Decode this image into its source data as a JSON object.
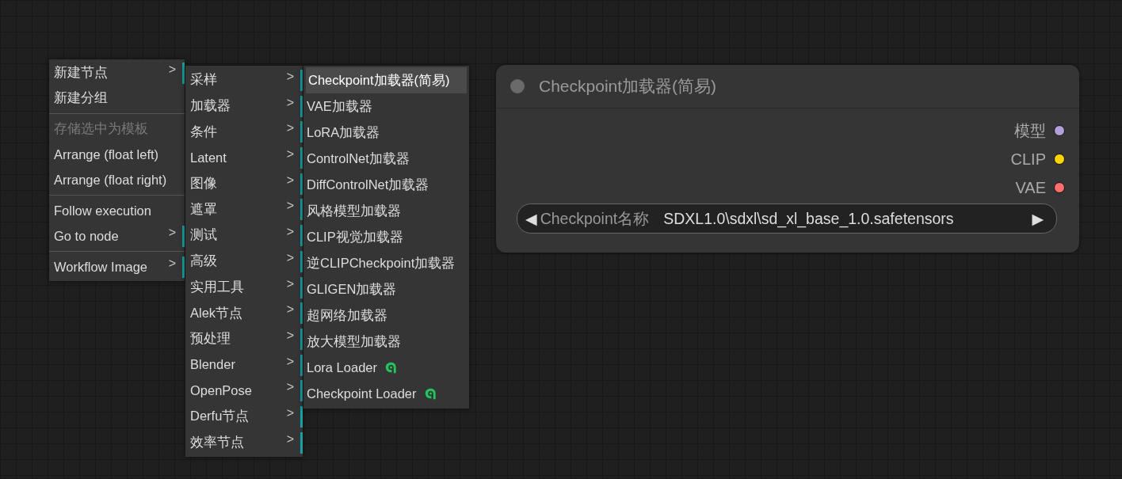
{
  "context_menus": [
    {
      "items": [
        {
          "label": "新建节点",
          "kind": "submenu",
          "arrow": ">",
          "disabled": false
        },
        {
          "label": "新建分组",
          "kind": "plain",
          "disabled": false
        },
        {
          "kind": "divider"
        },
        {
          "label": "存储选中为模板",
          "kind": "plain",
          "disabled": true
        },
        {
          "label": "Arrange (float left)",
          "kind": "plain",
          "disabled": false
        },
        {
          "label": "Arrange (float right)",
          "kind": "plain",
          "disabled": false
        },
        {
          "kind": "divider"
        },
        {
          "label": "Follow execution",
          "kind": "plain",
          "disabled": false
        },
        {
          "label": "Go to node",
          "kind": "submenu",
          "arrow": ">",
          "disabled": false
        },
        {
          "kind": "divider"
        },
        {
          "label": "Workflow Image",
          "kind": "submenu",
          "arrow": ">",
          "disabled": false
        }
      ]
    },
    {
      "items": [
        {
          "label": "采样",
          "kind": "submenu",
          "arrow": ">"
        },
        {
          "label": "加载器",
          "kind": "submenu",
          "arrow": ">"
        },
        {
          "label": "条件",
          "kind": "submenu",
          "arrow": ">"
        },
        {
          "label": "Latent",
          "kind": "submenu",
          "arrow": ">"
        },
        {
          "label": "图像",
          "kind": "submenu",
          "arrow": ">"
        },
        {
          "label": "遮罩",
          "kind": "submenu",
          "arrow": ">"
        },
        {
          "label": "测试",
          "kind": "submenu",
          "arrow": ">"
        },
        {
          "label": "高级",
          "kind": "submenu",
          "arrow": ">"
        },
        {
          "label": "实用工具",
          "kind": "submenu",
          "arrow": ">"
        },
        {
          "label": "Alek节点",
          "kind": "submenu",
          "arrow": ">"
        },
        {
          "label": "预处理",
          "kind": "submenu",
          "arrow": ">"
        },
        {
          "label": "Blender",
          "kind": "submenu",
          "arrow": ">"
        },
        {
          "label": "OpenPose",
          "kind": "submenu",
          "arrow": ">"
        },
        {
          "label": "Derfu节点",
          "kind": "submenu",
          "arrow": ">"
        },
        {
          "label": "效率节点",
          "kind": "submenu",
          "arrow": ">"
        }
      ]
    },
    {
      "items": [
        {
          "label": "Checkpoint加载器(简易)",
          "kind": "plain",
          "selected": true
        },
        {
          "label": "VAE加载器",
          "kind": "plain",
          "selected": false
        },
        {
          "label": "LoRA加载器",
          "kind": "plain",
          "selected": false
        },
        {
          "label": "ControlNet加载器",
          "kind": "plain",
          "selected": false
        },
        {
          "label": "DiffControlNet加载器",
          "kind": "plain",
          "selected": false
        },
        {
          "label": "风格模型加载器",
          "kind": "plain",
          "selected": false
        },
        {
          "label": "CLIP视觉加载器",
          "kind": "plain",
          "selected": false
        },
        {
          "label": "逆CLIPCheckpoint加载器",
          "kind": "plain",
          "selected": false
        },
        {
          "label": "GLIGEN加载器",
          "kind": "plain",
          "selected": false
        },
        {
          "label": "超网络加载器",
          "kind": "plain",
          "selected": false
        },
        {
          "label": "放大模型加载器",
          "kind": "plain",
          "selected": false
        },
        {
          "label": "Lora Loader",
          "kind": "extension",
          "selected": false
        },
        {
          "label": "Checkpoint Loader",
          "kind": "extension",
          "selected": false
        }
      ]
    }
  ],
  "node": {
    "title": "Checkpoint加载器(简易)",
    "outputs": [
      {
        "label": "模型",
        "color": "#b39ddb"
      },
      {
        "label": "CLIP",
        "color": "#ffd500"
      },
      {
        "label": "VAE",
        "color": "#ff6e6e"
      }
    ],
    "widget": {
      "left_arrow": "◀",
      "label": "Checkpoint名称",
      "value": "SDXL1.0\\sdxl\\sd_xl_base_1.0.safetensors",
      "right_arrow": "▶"
    }
  }
}
